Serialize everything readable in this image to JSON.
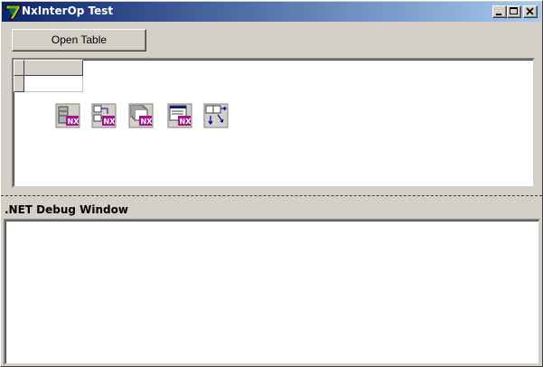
{
  "window": {
    "title": "NxInterOp Test",
    "app_icon": "nexusdb-7-icon",
    "controls": [
      "minimize-icon",
      "maximize-icon",
      "close-icon"
    ]
  },
  "toolbar": {
    "open_table_label": "Open Table"
  },
  "components": [
    {
      "icon": "nx-database-icon"
    },
    {
      "icon": "nx-session-icon"
    },
    {
      "icon": "nx-table-icon"
    },
    {
      "icon": "nx-query-icon"
    },
    {
      "icon": "datasource-icon"
    }
  ],
  "debug": {
    "label": ".NET Debug Window",
    "text": ""
  },
  "colors": {
    "title_start": "#0a246a",
    "title_end": "#a6caf0",
    "face": "#d4d0c8",
    "nx_magenta": "#a0148c"
  }
}
